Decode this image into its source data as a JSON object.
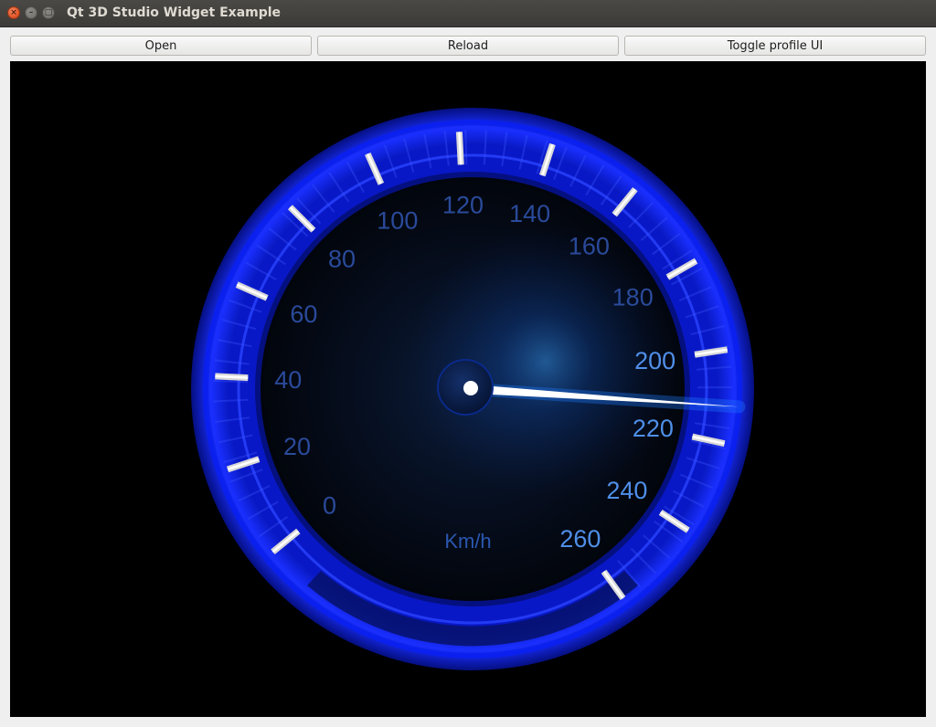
{
  "window": {
    "title": "Qt 3D Studio Widget Example",
    "close_glyph": "×",
    "minimize_glyph": "–",
    "maximize_glyph": "□"
  },
  "toolbar": {
    "open_label": "Open",
    "reload_label": "Reload",
    "toggle_label": "Toggle profile UI"
  },
  "gauge": {
    "unit": "Km/h",
    "min": 0,
    "max": 260,
    "value": 212,
    "ticks": [
      {
        "value": 0,
        "label": "0"
      },
      {
        "value": 20,
        "label": "20"
      },
      {
        "value": 40,
        "label": "40"
      },
      {
        "value": 60,
        "label": "60"
      },
      {
        "value": 80,
        "label": "80"
      },
      {
        "value": 100,
        "label": "100"
      },
      {
        "value": 120,
        "label": "120"
      },
      {
        "value": 140,
        "label": "140"
      },
      {
        "value": 160,
        "label": "160"
      },
      {
        "value": 180,
        "label": "180"
      },
      {
        "value": 200,
        "label": "200"
      },
      {
        "value": 220,
        "label": "220"
      },
      {
        "value": 240,
        "label": "240"
      },
      {
        "value": 260,
        "label": "260"
      }
    ],
    "colors": {
      "ring": "#0a1bd8",
      "ring_light": "#2f46ff",
      "label_dim": "#2a4a9a",
      "label_bright": "#4f8fe8",
      "needle": "#ffffff",
      "glow": "#1e7cff"
    }
  }
}
